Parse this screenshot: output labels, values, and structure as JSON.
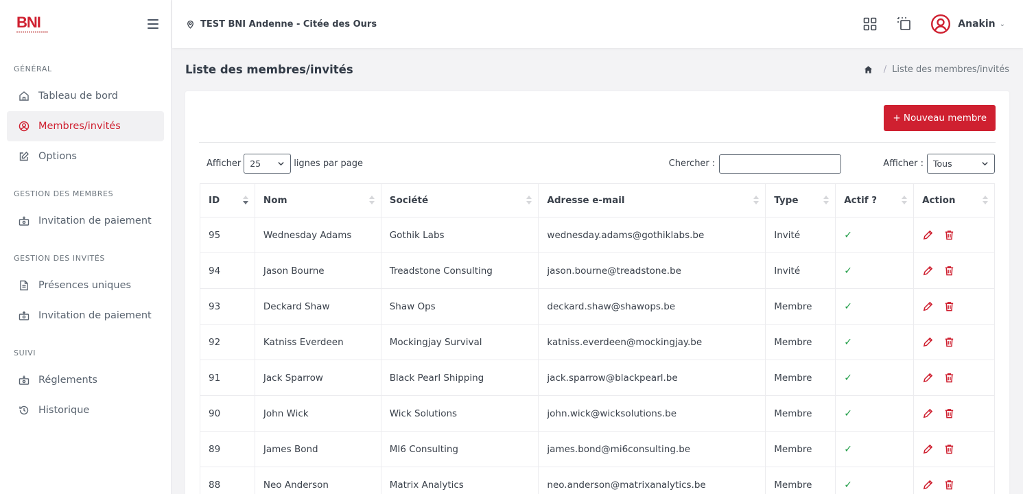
{
  "brand": {
    "logo_text": "BNI",
    "accent": "#cf2030"
  },
  "header": {
    "location": "TEST BNI Andenne - Citée des Ours",
    "user_name": "Anakin"
  },
  "sidebar": {
    "sections": [
      {
        "title": "GÉNÉRAL",
        "items": [
          {
            "label": "Tableau de bord",
            "icon": "home-icon"
          },
          {
            "label": "Membres/invités",
            "icon": "user-circle-icon",
            "active": true
          },
          {
            "label": "Options",
            "icon": "edit-icon"
          }
        ]
      },
      {
        "title": "GESTION DES MEMBRES",
        "items": [
          {
            "label": "Invitation de paiement",
            "icon": "payment-icon"
          }
        ]
      },
      {
        "title": "GESTION DES INVITÉS",
        "items": [
          {
            "label": "Présences uniques",
            "icon": "document-icon"
          },
          {
            "label": "Invitation de paiement",
            "icon": "payment-icon"
          }
        ]
      },
      {
        "title": "SUIVI",
        "items": [
          {
            "label": "Réglements",
            "icon": "payment-icon"
          },
          {
            "label": "Historique",
            "icon": "history-icon"
          }
        ]
      }
    ]
  },
  "page": {
    "title": "Liste des membres/invités",
    "breadcrumb": "Liste des membres/invités",
    "new_button": "+ Nouveau membre",
    "show_label": "Afficher",
    "page_size": "25",
    "per_page_label": "lignes par page",
    "search_label": "Chercher :",
    "search_value": "",
    "filter_label": "Afficher :",
    "filter_value": "Tous"
  },
  "table": {
    "columns": [
      "ID",
      "Nom",
      "Société",
      "Adresse e-mail",
      "Type",
      "Actif ?",
      "Action"
    ],
    "rows": [
      {
        "id": "95",
        "nom": "Wednesday Adams",
        "societe": "Gothik Labs",
        "email": "wednesday.adams@gothiklabs.be",
        "type": "Invité",
        "actif": "✓"
      },
      {
        "id": "94",
        "nom": "Jason Bourne",
        "societe": "Treadstone Consulting",
        "email": "jason.bourne@treadstone.be",
        "type": "Invité",
        "actif": "✓"
      },
      {
        "id": "93",
        "nom": "Deckard Shaw",
        "societe": "Shaw Ops",
        "email": "deckard.shaw@shawops.be",
        "type": "Membre",
        "actif": "✓"
      },
      {
        "id": "92",
        "nom": "Katniss Everdeen",
        "societe": "Mockingjay Survival",
        "email": "katniss.everdeen@mockingjay.be",
        "type": "Membre",
        "actif": "✓"
      },
      {
        "id": "91",
        "nom": "Jack Sparrow",
        "societe": "Black Pearl Shipping",
        "email": "jack.sparrow@blackpearl.be",
        "type": "Membre",
        "actif": "✓"
      },
      {
        "id": "90",
        "nom": "John Wick",
        "societe": "Wick Solutions",
        "email": "john.wick@wicksolutions.be",
        "type": "Membre",
        "actif": "✓"
      },
      {
        "id": "89",
        "nom": "James Bond",
        "societe": "MI6 Consulting",
        "email": "james.bond@mi6consulting.be",
        "type": "Membre",
        "actif": "✓"
      },
      {
        "id": "88",
        "nom": "Neo Anderson",
        "societe": "Matrix Analytics",
        "email": "neo.anderson@matrixanalytics.be",
        "type": "Membre",
        "actif": "✓"
      }
    ]
  }
}
